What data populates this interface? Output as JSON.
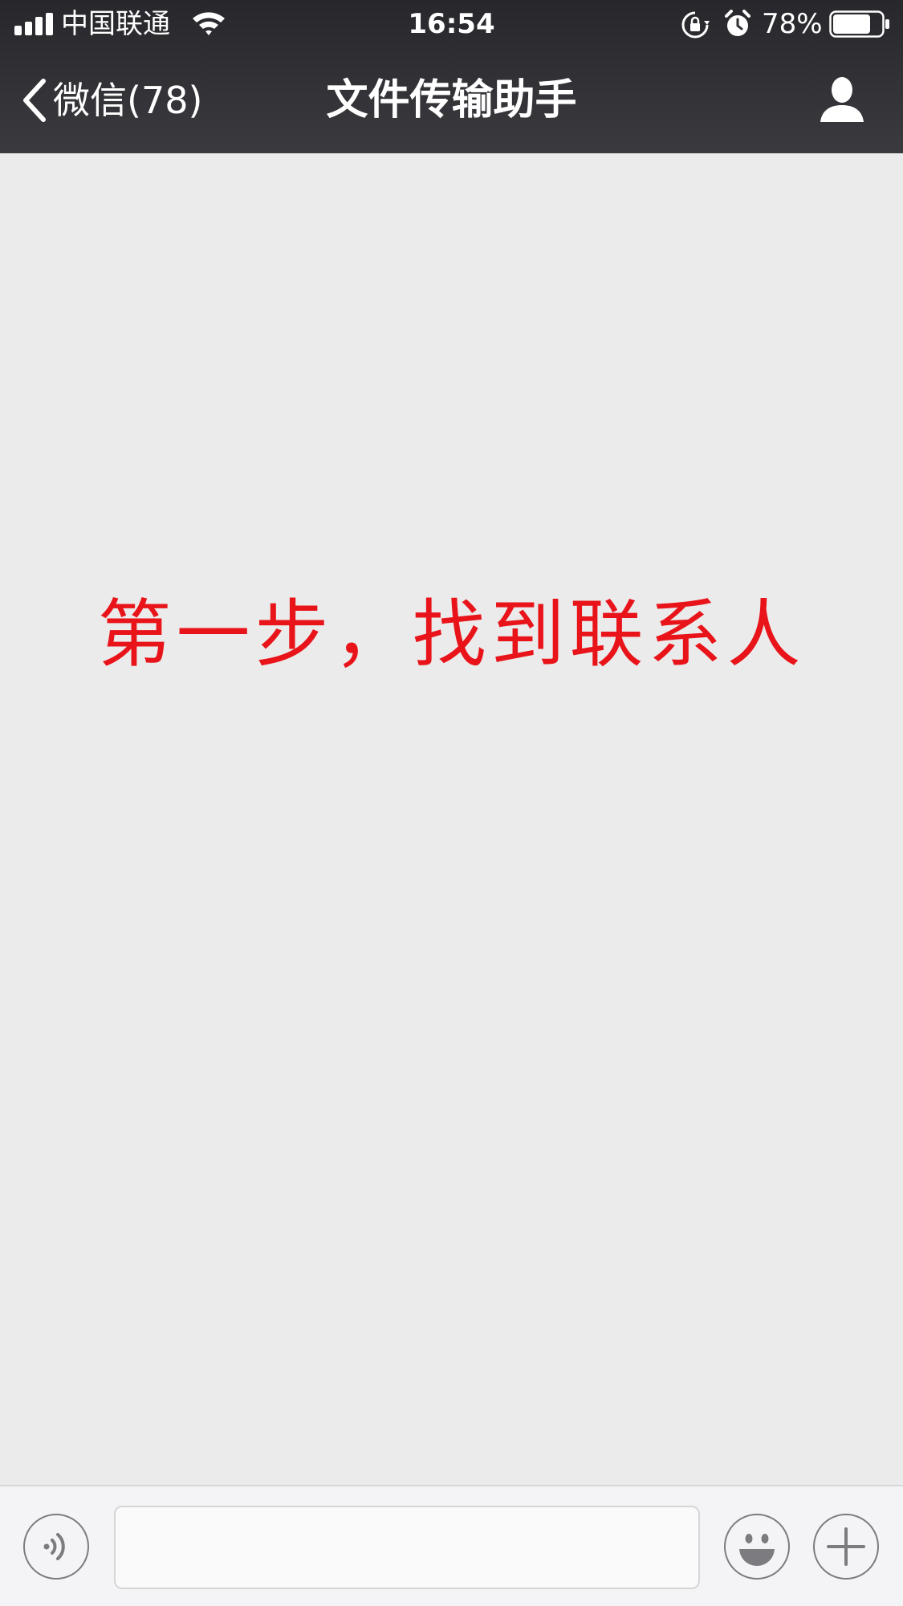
{
  "status_bar": {
    "carrier": "中国联通",
    "time": "16:54",
    "battery_percent": "78%",
    "battery_level": 0.78,
    "signal_bars": 4,
    "icons": [
      "signal-icon",
      "wifi-icon",
      "rotation-lock-icon",
      "alarm-icon",
      "battery-icon"
    ]
  },
  "nav": {
    "back_label": "微信(78)",
    "title": "文件传输助手",
    "icons": [
      "chevron-left-icon",
      "profile-icon"
    ]
  },
  "chat": {
    "overlay_text": "第一步，找到联系人"
  },
  "toolbar": {
    "input_value": "",
    "icons": [
      "voice-icon",
      "emoji-icon",
      "plus-icon"
    ]
  },
  "colors": {
    "header_bg": "#2e2e33",
    "chat_bg": "#ebebeb",
    "overlay_text": "#e8141a",
    "toolbar_bg": "#f4f4f6"
  }
}
